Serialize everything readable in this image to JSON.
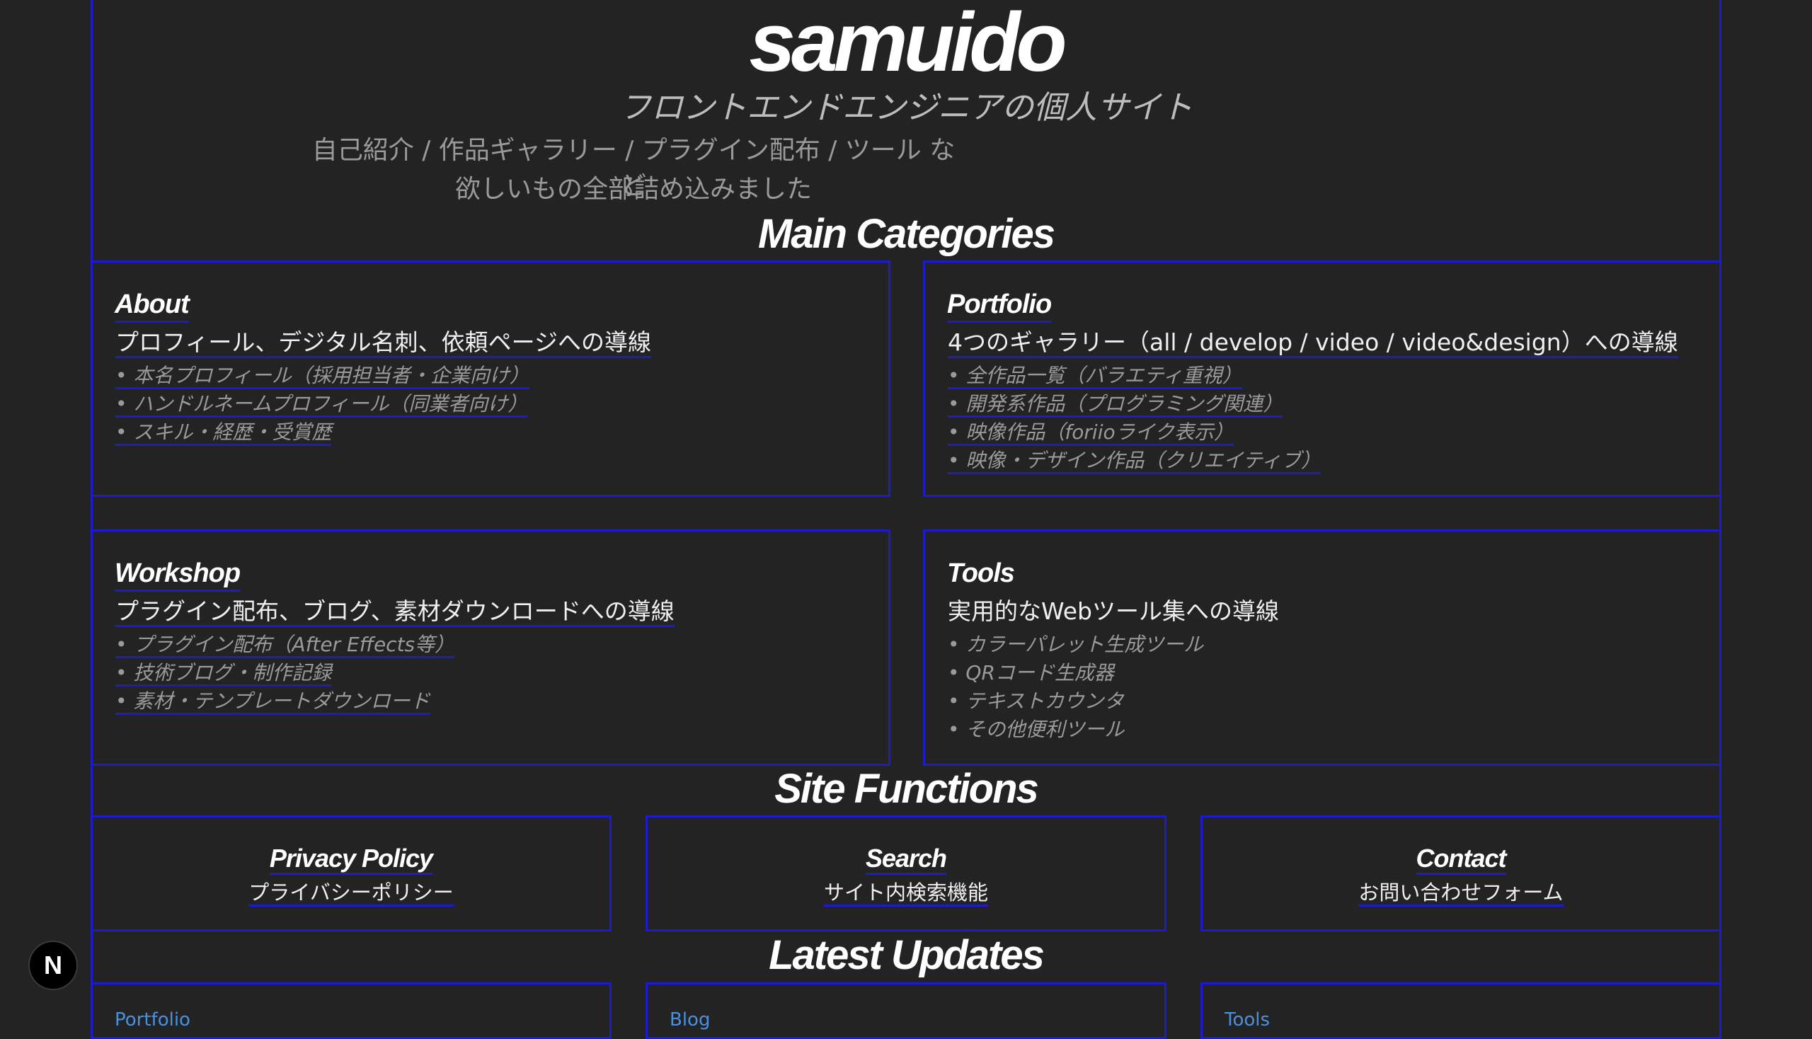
{
  "site": {
    "logo": "samuido",
    "tagline": "フロントエンドエンジニアの個人サイト",
    "description_line1": "自己紹介 / 作品ギャラリー / プラグイン配布 / ツール など",
    "description_line2": "欲しいもの全部詰め込みました"
  },
  "sections": {
    "main_categories": "Main Categories",
    "site_functions": "Site Functions",
    "latest_updates": "Latest Updates"
  },
  "categories": [
    {
      "title": "About",
      "subtitle": "プロフィール、デジタル名刺、依頼ページへの導線",
      "items": [
        "• 本名プロフィール（採用担当者・企業向け）",
        "• ハンドルネームプロフィール（同業者向け）",
        "• スキル・経歴・受賞歴"
      ]
    },
    {
      "title": "Portfolio",
      "subtitle": "4つのギャラリー（all / develop / video / video&design）への導線",
      "items": [
        "• 全作品一覧（バラエティ重視）",
        "• 開発系作品（プログラミング関連）",
        "• 映像作品（foriioライク表示）",
        "• 映像・デザイン作品（クリエイティブ）"
      ]
    },
    {
      "title": "Workshop",
      "subtitle": "プラグイン配布、ブログ、素材ダウンロードへの導線",
      "items": [
        "• プラグイン配布（After Effects等）",
        "• 技術ブログ・制作記録",
        "• 素材・テンプレートダウンロード"
      ]
    },
    {
      "title": "Tools",
      "subtitle": "実用的なWebツール集への導線",
      "items": [
        "• カラーパレット生成ツール",
        "• QRコード生成器",
        "• テキストカウンタ",
        "• その他便利ツール"
      ]
    }
  ],
  "functions": [
    {
      "title": "Privacy Policy",
      "subtitle": "プライバシーポリシー"
    },
    {
      "title": "Search",
      "subtitle": "サイト内検索機能"
    },
    {
      "title": "Contact",
      "subtitle": "お問い合わせフォーム"
    }
  ],
  "updates": [
    {
      "label": "Portfolio"
    },
    {
      "label": "Blog"
    },
    {
      "label": "Tools"
    }
  ],
  "badge": {
    "letter": "N"
  }
}
